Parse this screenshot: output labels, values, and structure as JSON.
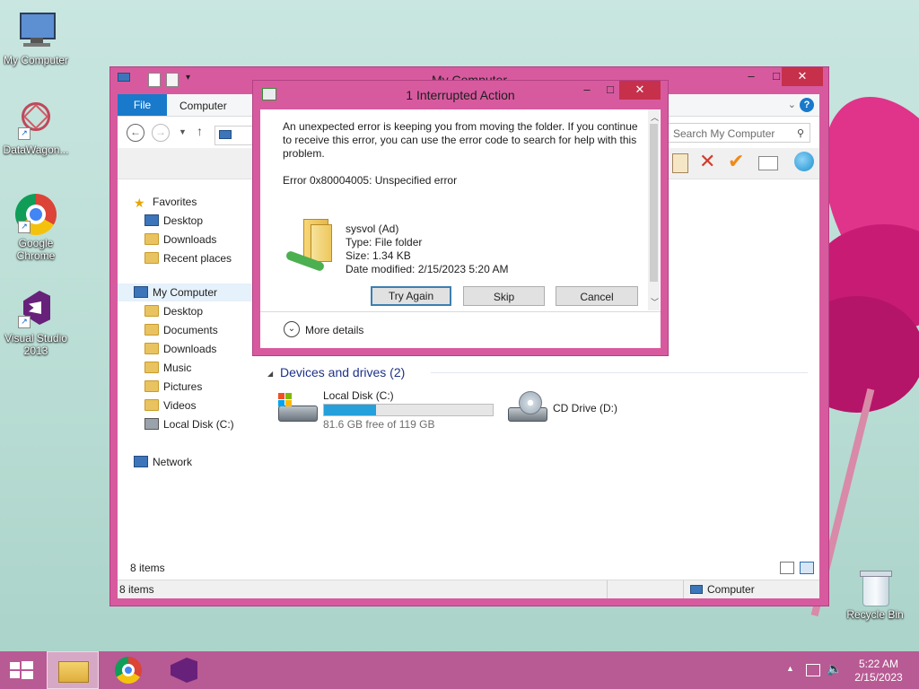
{
  "desktop": {
    "icons": [
      {
        "label": "My Computer"
      },
      {
        "label": "DataWagon..."
      },
      {
        "label": "Google Chrome"
      },
      {
        "label": "Visual Studio 2013"
      },
      {
        "label": "Recycle Bin"
      }
    ]
  },
  "explorer": {
    "title": "My Computer",
    "tabs": {
      "file": "File",
      "computer": "Computer"
    },
    "search_placeholder": "Search My Computer",
    "nav": {
      "favorites": "Favorites",
      "fav_items": [
        "Desktop",
        "Downloads",
        "Recent places"
      ],
      "my_computer": "My Computer",
      "pc_items": [
        "Desktop",
        "Documents",
        "Downloads",
        "Music",
        "Pictures",
        "Videos",
        "Local Disk (C:)"
      ],
      "network": "Network"
    },
    "devices_header": "Devices and drives (2)",
    "drives": [
      {
        "name": "Local Disk (C:)",
        "free": "81.6 GB free of 119 GB",
        "used_fraction": 0.31
      },
      {
        "name": "CD Drive (D:)"
      }
    ],
    "items_count": "8 items",
    "status_items": "8 items",
    "status_location": "Computer"
  },
  "dialog": {
    "title": "1 Interrupted Action",
    "message": "An unexpected error is keeping you from moving the folder. If you continue to receive this error, you can use the error code to search for help with this problem.",
    "error": "Error 0x80004005: Unspecified error",
    "item": {
      "name": "sysvol (Ad)",
      "type": "Type: File folder",
      "size": "Size: 1.34 KB",
      "modified": "Date modified: 2/15/2023 5:20 AM"
    },
    "buttons": {
      "try_again": "Try Again",
      "skip": "Skip",
      "cancel": "Cancel"
    },
    "more_details": "More details"
  },
  "taskbar": {
    "time": "5:22 AM",
    "date": "2/15/2023"
  },
  "colors": {
    "accent": "#d75a9f",
    "close": "#c7304b",
    "file_tab": "#1979ca",
    "taskbar": "#b85a94"
  }
}
